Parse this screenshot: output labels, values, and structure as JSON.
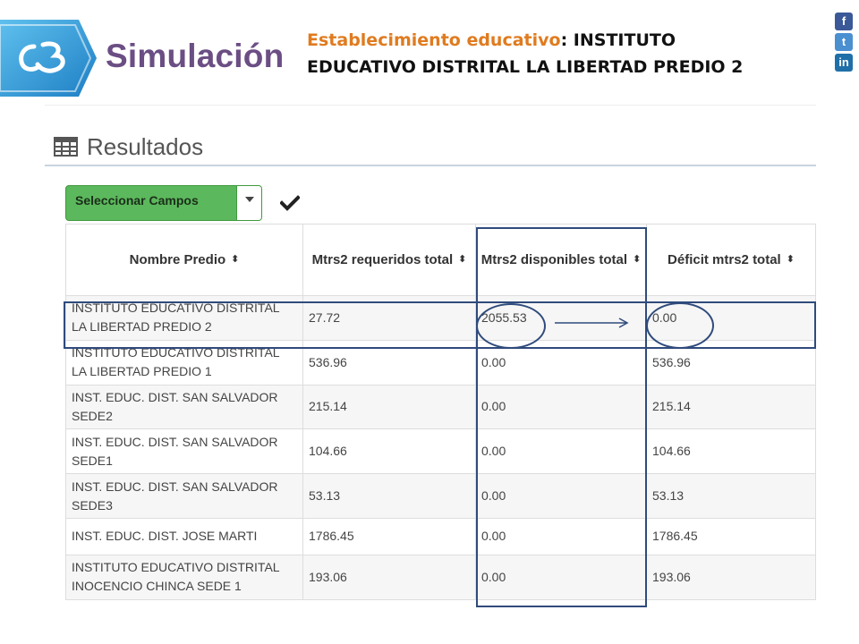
{
  "header": {
    "title": "Simulación",
    "establishment_label": "Establecimiento educativo",
    "establishment_separator": ": ",
    "establishment_name": "INSTITUTO EDUCATIVO DISTRITAL LA LIBERTAD PREDIO 2"
  },
  "social": {
    "facebook_glyph": "f",
    "twitter_glyph": "t",
    "linkedin_glyph": "in"
  },
  "results": {
    "title": "Resultados",
    "select_fields_label": "Seleccionar Campos"
  },
  "table": {
    "columns": [
      "Nombre Predio",
      "Mtrs2 requeridos total",
      "Mtrs2 disponibles total",
      "Déficit mtrs2 total"
    ],
    "rows": [
      [
        "INSTITUTO EDUCATIVO DISTRITAL LA LIBERTAD PREDIO 2",
        "27.72",
        "2055.53",
        "0.00"
      ],
      [
        "INSTITUTO EDUCATIVO DISTRITAL LA LIBERTAD PREDIO 1",
        "536.96",
        "0.00",
        "536.96"
      ],
      [
        "INST. EDUC. DIST. SAN SALVADOR SEDE2",
        "215.14",
        "0.00",
        "215.14"
      ],
      [
        "INST. EDUC. DIST. SAN SALVADOR SEDE1",
        "104.66",
        "0.00",
        "104.66"
      ],
      [
        "INST. EDUC. DIST. SAN SALVADOR SEDE3",
        "53.13",
        "0.00",
        "53.13"
      ],
      [
        "INST. EDUC. DIST. JOSE MARTI",
        "1786.45",
        "0.00",
        "1786.45"
      ],
      [
        "INSTITUTO EDUCATIVO DISTRITAL INOCENCIO CHINCA SEDE 1",
        "193.06",
        "0.00",
        "193.06"
      ]
    ]
  },
  "colors": {
    "title": "#6b4e84",
    "label_orange": "#e07b1f",
    "select_button": "#5cb85c",
    "annotation": "#2f4b7c",
    "logo_blue": "#1e8fd0"
  }
}
